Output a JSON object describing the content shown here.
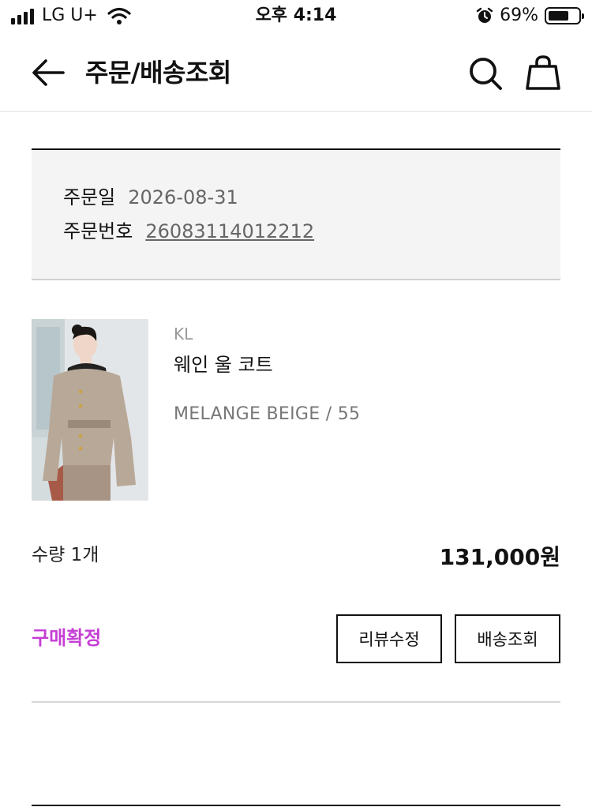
{
  "status_bar": {
    "carrier": "LG U+",
    "time": "오후 4:14",
    "battery_percent": "69%",
    "battery_level": 0.69
  },
  "header": {
    "title": "주문/배송조회",
    "back_icon": "arrow-left-icon",
    "search_icon": "search-icon",
    "bag_icon": "shopping-bag-icon"
  },
  "order": {
    "date_label": "주문일",
    "date_value": "2026-08-31",
    "number_label": "주문번호",
    "number_value": "26083114012212"
  },
  "product": {
    "brand": "KL",
    "name": "웨인 울 코트",
    "option": "MELANGE BEIGE / 55",
    "quantity": "수량 1개",
    "price": "131,000원"
  },
  "actions": {
    "status": "구매확정",
    "review_button": "리뷰수정",
    "shipping_button": "배송조회"
  },
  "colors": {
    "status_accent": "#c53ed4",
    "info_box_bg": "#f4f4f4"
  }
}
